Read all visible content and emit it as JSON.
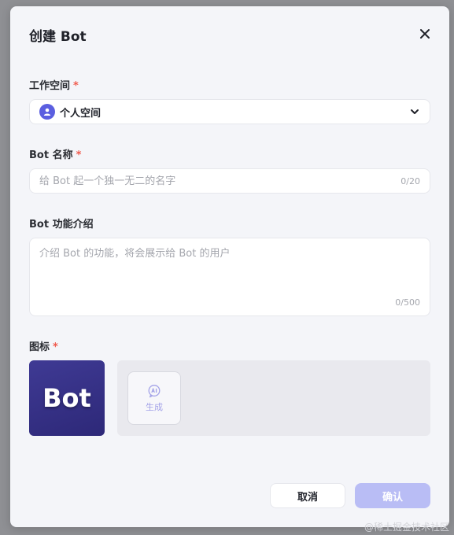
{
  "dialog": {
    "title": "创建 Bot",
    "close_icon": "close-icon"
  },
  "workspace": {
    "label": "工作空间",
    "required_mark": "*",
    "selected": "个人空间",
    "icon": "user-icon"
  },
  "bot_name": {
    "label": "Bot 名称",
    "required_mark": "*",
    "placeholder": "给 Bot 起一个独一无二的名字",
    "counter": "0/20"
  },
  "bot_description": {
    "label": "Bot 功能介绍",
    "placeholder": "介绍 Bot 的功能，将会展示给 Bot 的用户",
    "counter": "0/500"
  },
  "icon_section": {
    "label": "图标",
    "required_mark": "*",
    "preview_text": "Bot",
    "generate_label": "生成",
    "generate_icon": "ai-icon"
  },
  "actions": {
    "cancel": "取消",
    "confirm": "确认"
  },
  "watermark": "@稀土掘金技术社区",
  "colors": {
    "accent": "#5b5fe0",
    "confirm_disabled": "#b9bdf5",
    "required": "#f05a4d"
  }
}
